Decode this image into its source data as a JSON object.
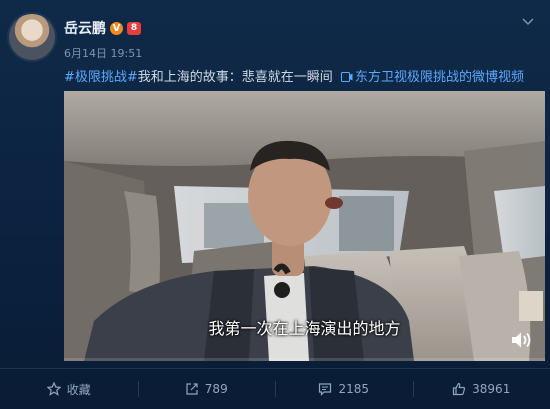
{
  "post": {
    "username": "岳云鹏",
    "verified_badge": "V",
    "level_badge": "8",
    "timestamp": "6月14日 19:51",
    "hashtag": "#极限挑战#",
    "body": "我和上海的故事：悲喜就在一瞬间",
    "link_text": "东方卫视极限挑战的微博视频"
  },
  "video": {
    "subtitle": "我第一次在上海演出的地方",
    "progress": 0.0
  },
  "actions": [
    {
      "icon": "star-icon",
      "label": "收藏"
    },
    {
      "icon": "share-icon",
      "label": "789"
    },
    {
      "icon": "comment-icon",
      "label": "2185"
    },
    {
      "icon": "like-icon",
      "label": "38961"
    }
  ],
  "colors": {
    "background": "#0b2240",
    "link": "#5aa9ff",
    "muted": "#7e95b0"
  }
}
